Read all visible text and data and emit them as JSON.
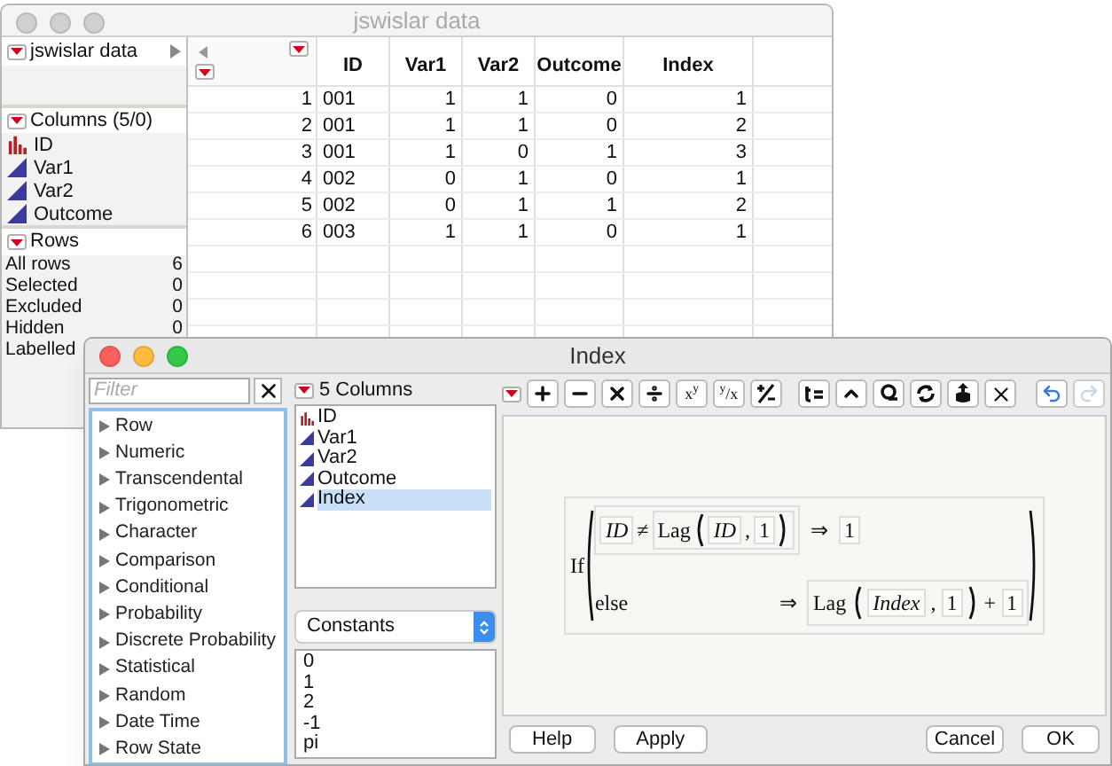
{
  "data_window": {
    "title": "jswislar data",
    "active": false,
    "table_panel": {
      "name": "jswislar data"
    },
    "columns_panel": {
      "title": "Columns (5/0)",
      "columns": [
        {
          "name": "ID",
          "kind": "nominal"
        },
        {
          "name": "Var1",
          "kind": "continuous"
        },
        {
          "name": "Var2",
          "kind": "continuous"
        },
        {
          "name": "Outcome",
          "kind": "continuous"
        }
      ]
    },
    "rows_panel": {
      "title": "Rows",
      "rows": [
        {
          "label": "All rows",
          "value": "6"
        },
        {
          "label": "Selected",
          "value": "0"
        },
        {
          "label": "Excluded",
          "value": "0"
        },
        {
          "label": "Hidden",
          "value": "0"
        },
        {
          "label": "Labelled"
        }
      ]
    },
    "table": {
      "columns": [
        "ID",
        "Var1",
        "Var2",
        "Outcome",
        "Index"
      ],
      "rows": [
        {
          "number": "1",
          "cells": [
            "001",
            "1",
            "1",
            "0",
            "1"
          ]
        },
        {
          "number": "2",
          "cells": [
            "001",
            "1",
            "1",
            "0",
            "2"
          ]
        },
        {
          "number": "3",
          "cells": [
            "001",
            "1",
            "0",
            "1",
            "3"
          ]
        },
        {
          "number": "4",
          "cells": [
            "002",
            "0",
            "1",
            "0",
            "1"
          ]
        },
        {
          "number": "5",
          "cells": [
            "002",
            "0",
            "1",
            "1",
            "2"
          ]
        },
        {
          "number": "6",
          "cells": [
            "003",
            "1",
            "1",
            "0",
            "1"
          ]
        }
      ]
    }
  },
  "formula_window": {
    "title": "Index",
    "active": true,
    "filter": {
      "placeholder": "Filter"
    },
    "function_groups": [
      {
        "label": "Row",
        "expanded": false
      },
      {
        "label": "Numeric",
        "expanded": false
      },
      {
        "label": "Transcendental",
        "expanded": false
      },
      {
        "label": "Trigonometric",
        "expanded": false
      },
      {
        "label": "Character",
        "expanded": false
      },
      {
        "label": "Comparison",
        "expanded": false
      },
      {
        "label": "Conditional",
        "expanded": false
      },
      {
        "label": "Probability",
        "expanded": false
      },
      {
        "label": "Discrete Probability",
        "expanded": false
      },
      {
        "label": "Statistical",
        "expanded": false
      },
      {
        "label": "Random",
        "expanded": false
      },
      {
        "label": "Date Time",
        "expanded": false
      },
      {
        "label": "Row State",
        "expanded": false
      }
    ],
    "columns_header": "5 Columns",
    "columns": [
      {
        "name": "ID",
        "kind": "nominal",
        "selected": false
      },
      {
        "name": "Var1",
        "kind": "continuous",
        "selected": false
      },
      {
        "name": "Var2",
        "kind": "continuous",
        "selected": false
      },
      {
        "name": "Outcome",
        "kind": "continuous",
        "selected": false
      },
      {
        "name": "Index",
        "kind": "continuous",
        "selected": true
      }
    ],
    "constants_select": {
      "value": "Constants"
    },
    "constants": [
      "0",
      "1",
      "2",
      "-1",
      "pi"
    ],
    "toolbar": {
      "power": "x$^{y}$",
      "root": "$^{y}$/x",
      "undo_disabled": false,
      "redo_disabled": true
    },
    "formula": {
      "function": "If",
      "condition": {
        "left": "ID",
        "operator": "≠",
        "lag": "Lag",
        "lag_column": "ID",
        "comma": ",",
        "lag_n": "1"
      },
      "arrow": "⇒",
      "result": "1",
      "else_label": "else",
      "else_arrow": "⇒",
      "else_result": {
        "lag": "Lag",
        "lag_column": "Index",
        "comma": ",",
        "lag_n": "1",
        "plus": "+",
        "addend": "1"
      }
    },
    "buttons": {
      "left": [
        "Help",
        "Apply"
      ],
      "right": [
        "Cancel",
        "OK"
      ]
    }
  }
}
